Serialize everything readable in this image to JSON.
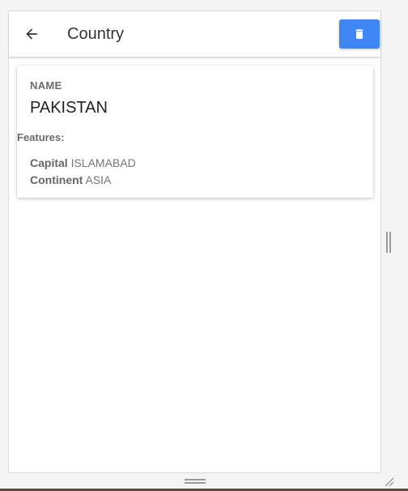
{
  "header": {
    "title": "Country",
    "back_icon": "arrow-left-icon",
    "delete_icon": "trash-icon",
    "delete_color": "#3f86f5"
  },
  "country": {
    "name_label": "NAME",
    "name_value": "PAKISTAN",
    "features_label": "Features:",
    "features": [
      {
        "key": "Capital",
        "value": "ISLAMABAD"
      },
      {
        "key": "Continent",
        "value": "ASIA"
      }
    ]
  }
}
